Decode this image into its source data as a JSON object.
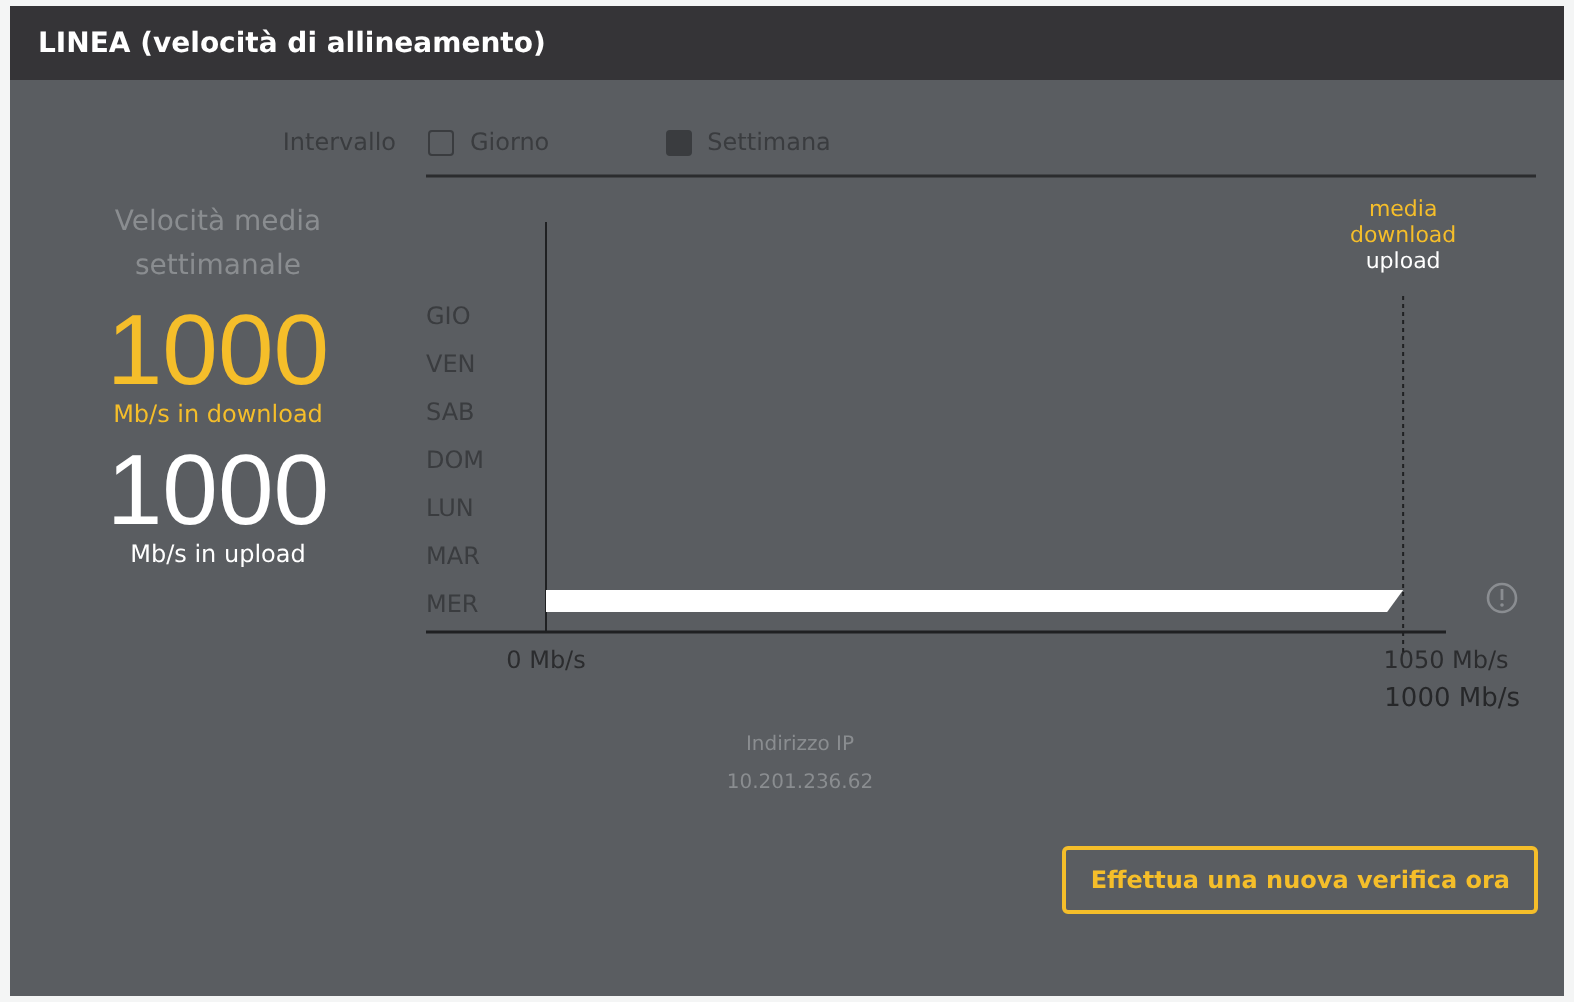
{
  "header": {
    "title": "LINEA (velocità di allineamento)"
  },
  "interval": {
    "label": "Intervallo",
    "options": [
      {
        "label": "Giorno",
        "selected": false
      },
      {
        "label": "Settimana",
        "selected": true
      }
    ]
  },
  "summary": {
    "title": "Velocità media settimanale",
    "download_value": "1000",
    "download_unit": "Mb/s in download",
    "upload_value": "1000",
    "upload_unit": "Mb/s in upload"
  },
  "chart": {
    "chart_data": {
      "type": "bar",
      "orientation": "horizontal",
      "categories": [
        "GIO",
        "VEN",
        "SAB",
        "DOM",
        "LUN",
        "MAR",
        "MER"
      ],
      "values": [
        null,
        null,
        null,
        null,
        null,
        null,
        1000
      ],
      "xlim": [
        0,
        1050
      ],
      "xticks": [
        {
          "value": 0,
          "label": "0 Mb/s"
        },
        {
          "value": 1050,
          "label": "1050 Mb/s"
        }
      ],
      "ref_lines": [
        {
          "axis": "x",
          "value": 1000
        }
      ]
    },
    "average_labels": [
      {
        "text": "media",
        "color": "#f5be2a"
      },
      {
        "text": "download",
        "color": "#f5be2a"
      },
      {
        "text": "upload",
        "color": "#ffffff"
      }
    ],
    "reading": "1000 Mb/s"
  },
  "ip": {
    "label": "Indirizzo IP",
    "value": "10.201.236.62"
  },
  "button": "Effettua una nuova verifica ora"
}
